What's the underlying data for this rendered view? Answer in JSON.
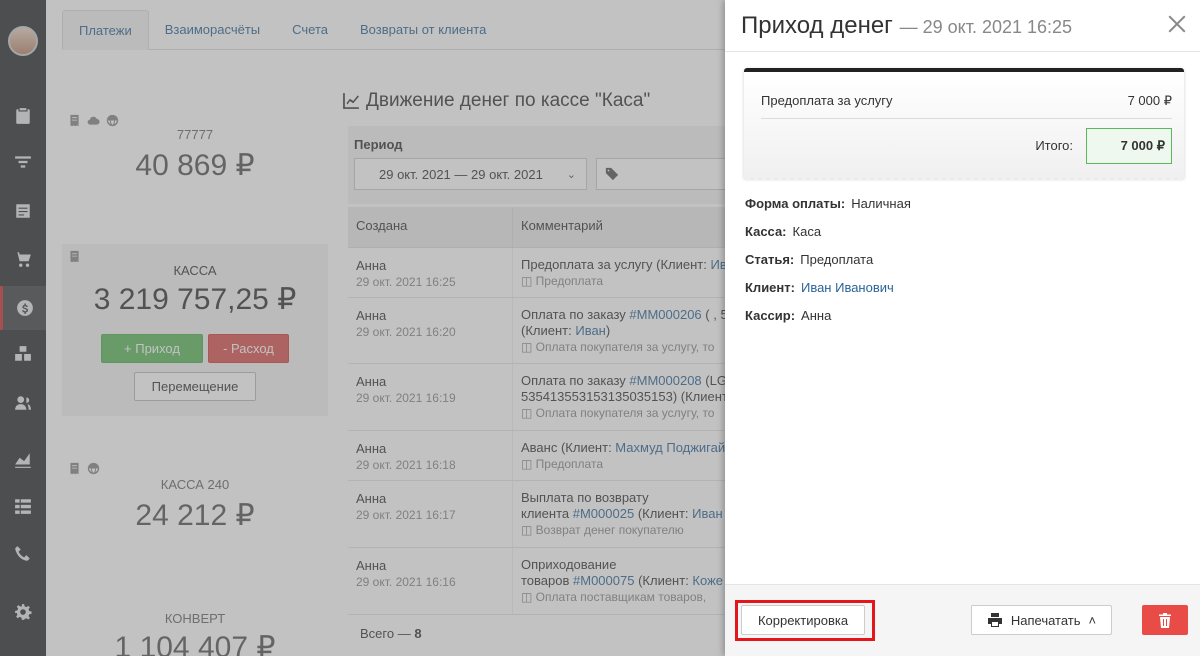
{
  "tabs": [
    {
      "label": "Платежи"
    },
    {
      "label": "Взаиморасчёты"
    },
    {
      "label": "Счета"
    },
    {
      "label": "Возвраты от клиента"
    }
  ],
  "cashboxes": [
    {
      "name": "77777",
      "sum": "40 869 ₽"
    },
    {
      "name": "КАССА",
      "sum": "3 219 757,25 ₽"
    },
    {
      "name": "КАССА 240",
      "sum": "24 212 ₽"
    },
    {
      "name": "КОНВЕРТ",
      "sum": "1 104 407 ₽"
    }
  ],
  "cashbox_buttons": {
    "income": "+ Приход",
    "expense": "- Расход",
    "move": "Перемещение"
  },
  "panel": {
    "title": "Движение денег по кассе \"Каса\"",
    "period_label": "Период",
    "period_value": "29 окт. 2021 — 29 окт. 2021"
  },
  "table": {
    "headers": [
      "Создана",
      "Комментарий"
    ],
    "rows": [
      {
        "who": "Анна",
        "when": "29 окт. 2021 16:25",
        "l1": "Предоплата за услугу  (Клиент: ",
        "l1link": "Иван",
        "l2": "",
        "l2link": "",
        "sub": "Предоплата"
      },
      {
        "who": "Анна",
        "when": "29 окт. 2021 16:20",
        "l1": "Оплата по заказу ",
        "l1link": "#MM000206",
        "l1tail": " ( , 5",
        "l2": "(Клиент: ",
        "l2link": "Иван",
        "l2tail": ")",
        "sub": "Оплата покупателя за услугу, то"
      },
      {
        "who": "Анна",
        "when": "29 окт. 2021 16:19",
        "l1": "Оплата по заказу ",
        "l1link": "#MM000208",
        "l1tail": " (LG",
        "l2": "535413553153135035153)",
        "l2link": "",
        "l2tail": " (Клиент",
        "sub": "Оплата покупателя за услугу, то"
      },
      {
        "who": "Анна",
        "when": "29 окт. 2021 16:18",
        "l1": "Аванс  (Клиент: ",
        "l1link": "Махмуд Поджигай",
        "l2": "",
        "l2link": "",
        "sub": "Предоплата"
      },
      {
        "who": "Анна",
        "when": "29 окт. 2021 16:17",
        "l1": "Выплата по возврату",
        "l1link": "",
        "l2": "клиента ",
        "l2link": "#M000025",
        "l2tail": " (Клиент: ",
        "l2link2": "Иван",
        "sub": "Возврат денег покупателю"
      },
      {
        "who": "Анна",
        "when": "29 окт. 2021 16:16",
        "l1": "Оприходование",
        "l1link": "",
        "l2": "товаров ",
        "l2link": "#M000075",
        "l2tail": " (Клиент: ",
        "l2link2": "Коже",
        "sub": "Оплата поставщикам товаров, "
      }
    ],
    "total_label": "Всего — ",
    "total_value": "8"
  },
  "drawer": {
    "title": "Приход денег",
    "date": "— 29 окт. 2021 16:25",
    "receipt_item": "Предоплата за услугу",
    "receipt_item_sum": "7 000 ₽",
    "receipt_total_label": "Итого:",
    "receipt_total": "7 000 ₽",
    "details": [
      {
        "label": "Форма оплаты:",
        "value": "Наличная"
      },
      {
        "label": "Касса:",
        "value": "Каса"
      },
      {
        "label": "Статья:",
        "value": "Предоплата"
      },
      {
        "label": "Клиент:",
        "value": "Иван Иванович"
      },
      {
        "label": "Кассир:",
        "value": "Анна"
      }
    ],
    "correct_button": "Корректировка",
    "print_button": "Напечатать",
    "print_chevron": "˄"
  },
  "colors": {
    "accent_link": "#2a6496",
    "green": "#5cb85c",
    "red": "#d9534f",
    "highlight_frame": "#e3161b"
  }
}
